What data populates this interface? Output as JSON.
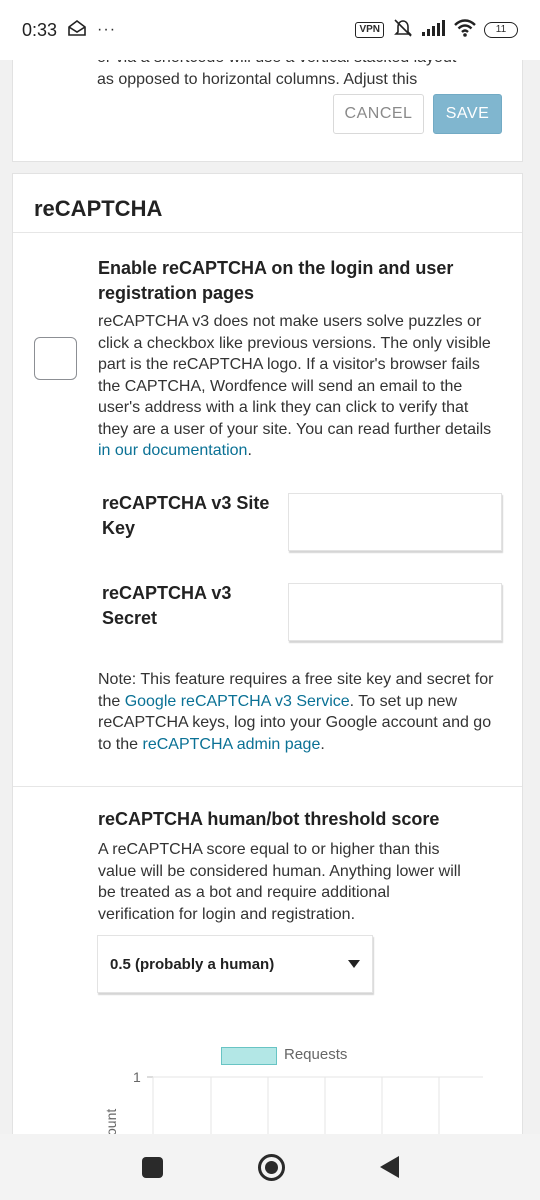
{
  "status_bar": {
    "time": "0:33",
    "dots": "···",
    "vpn": "VPN",
    "battery": "11"
  },
  "top_card": {
    "text_line1": "or via a shortcode will use a vertical stacked layout",
    "text_line2": "as opposed to horizontal columns. Adjust this",
    "cancel_label": "CANCEL",
    "save_label": "SAVE"
  },
  "recaptcha": {
    "title": "reCAPTCHA",
    "enable_heading": "Enable reCAPTCHA on the login and user registration pages",
    "enable_desc": "reCAPTCHA v3 does not make users solve puzzles or click a checkbox like previous versions. The only visible part is the reCAPTCHA logo. If a visitor's browser fails the CAPTCHA, Wordfence will send an email to the user's address with a link they can click to verify that they are a user of your site. You can read further details ",
    "doc_link": "in our documentation",
    "period": ".",
    "site_key_label": "reCAPTCHA v3 Site Key",
    "site_key_value": "",
    "secret_label": "reCAPTCHA v3 Secret",
    "secret_value": "",
    "note_part1": "Note: This feature requires a free site key and secret for the ",
    "note_link1": "Google reCAPTCHA v3 Service",
    "note_part2": ". To set up new reCAPTCHA keys, log into your Google account and go to the ",
    "note_link2": "reCAPTCHA admin page",
    "note_part3": ".",
    "threshold_heading": "reCAPTCHA human/bot threshold score",
    "threshold_desc": "A reCAPTCHA score equal to or higher than this value will be considered human. Anything lower will be treated as a bot and require additional verification for login and registration.",
    "threshold_selected": "0.5 (probably a human)"
  },
  "chart_data": {
    "type": "bar",
    "series": [
      {
        "name": "Requests",
        "values": []
      }
    ],
    "ylabel": "ount",
    "y_ticks": [
      "1"
    ]
  },
  "colors": {
    "accent_link": "#0a7195",
    "save_button": "#80b6cf",
    "legend_fill": "#b3e7e6"
  }
}
